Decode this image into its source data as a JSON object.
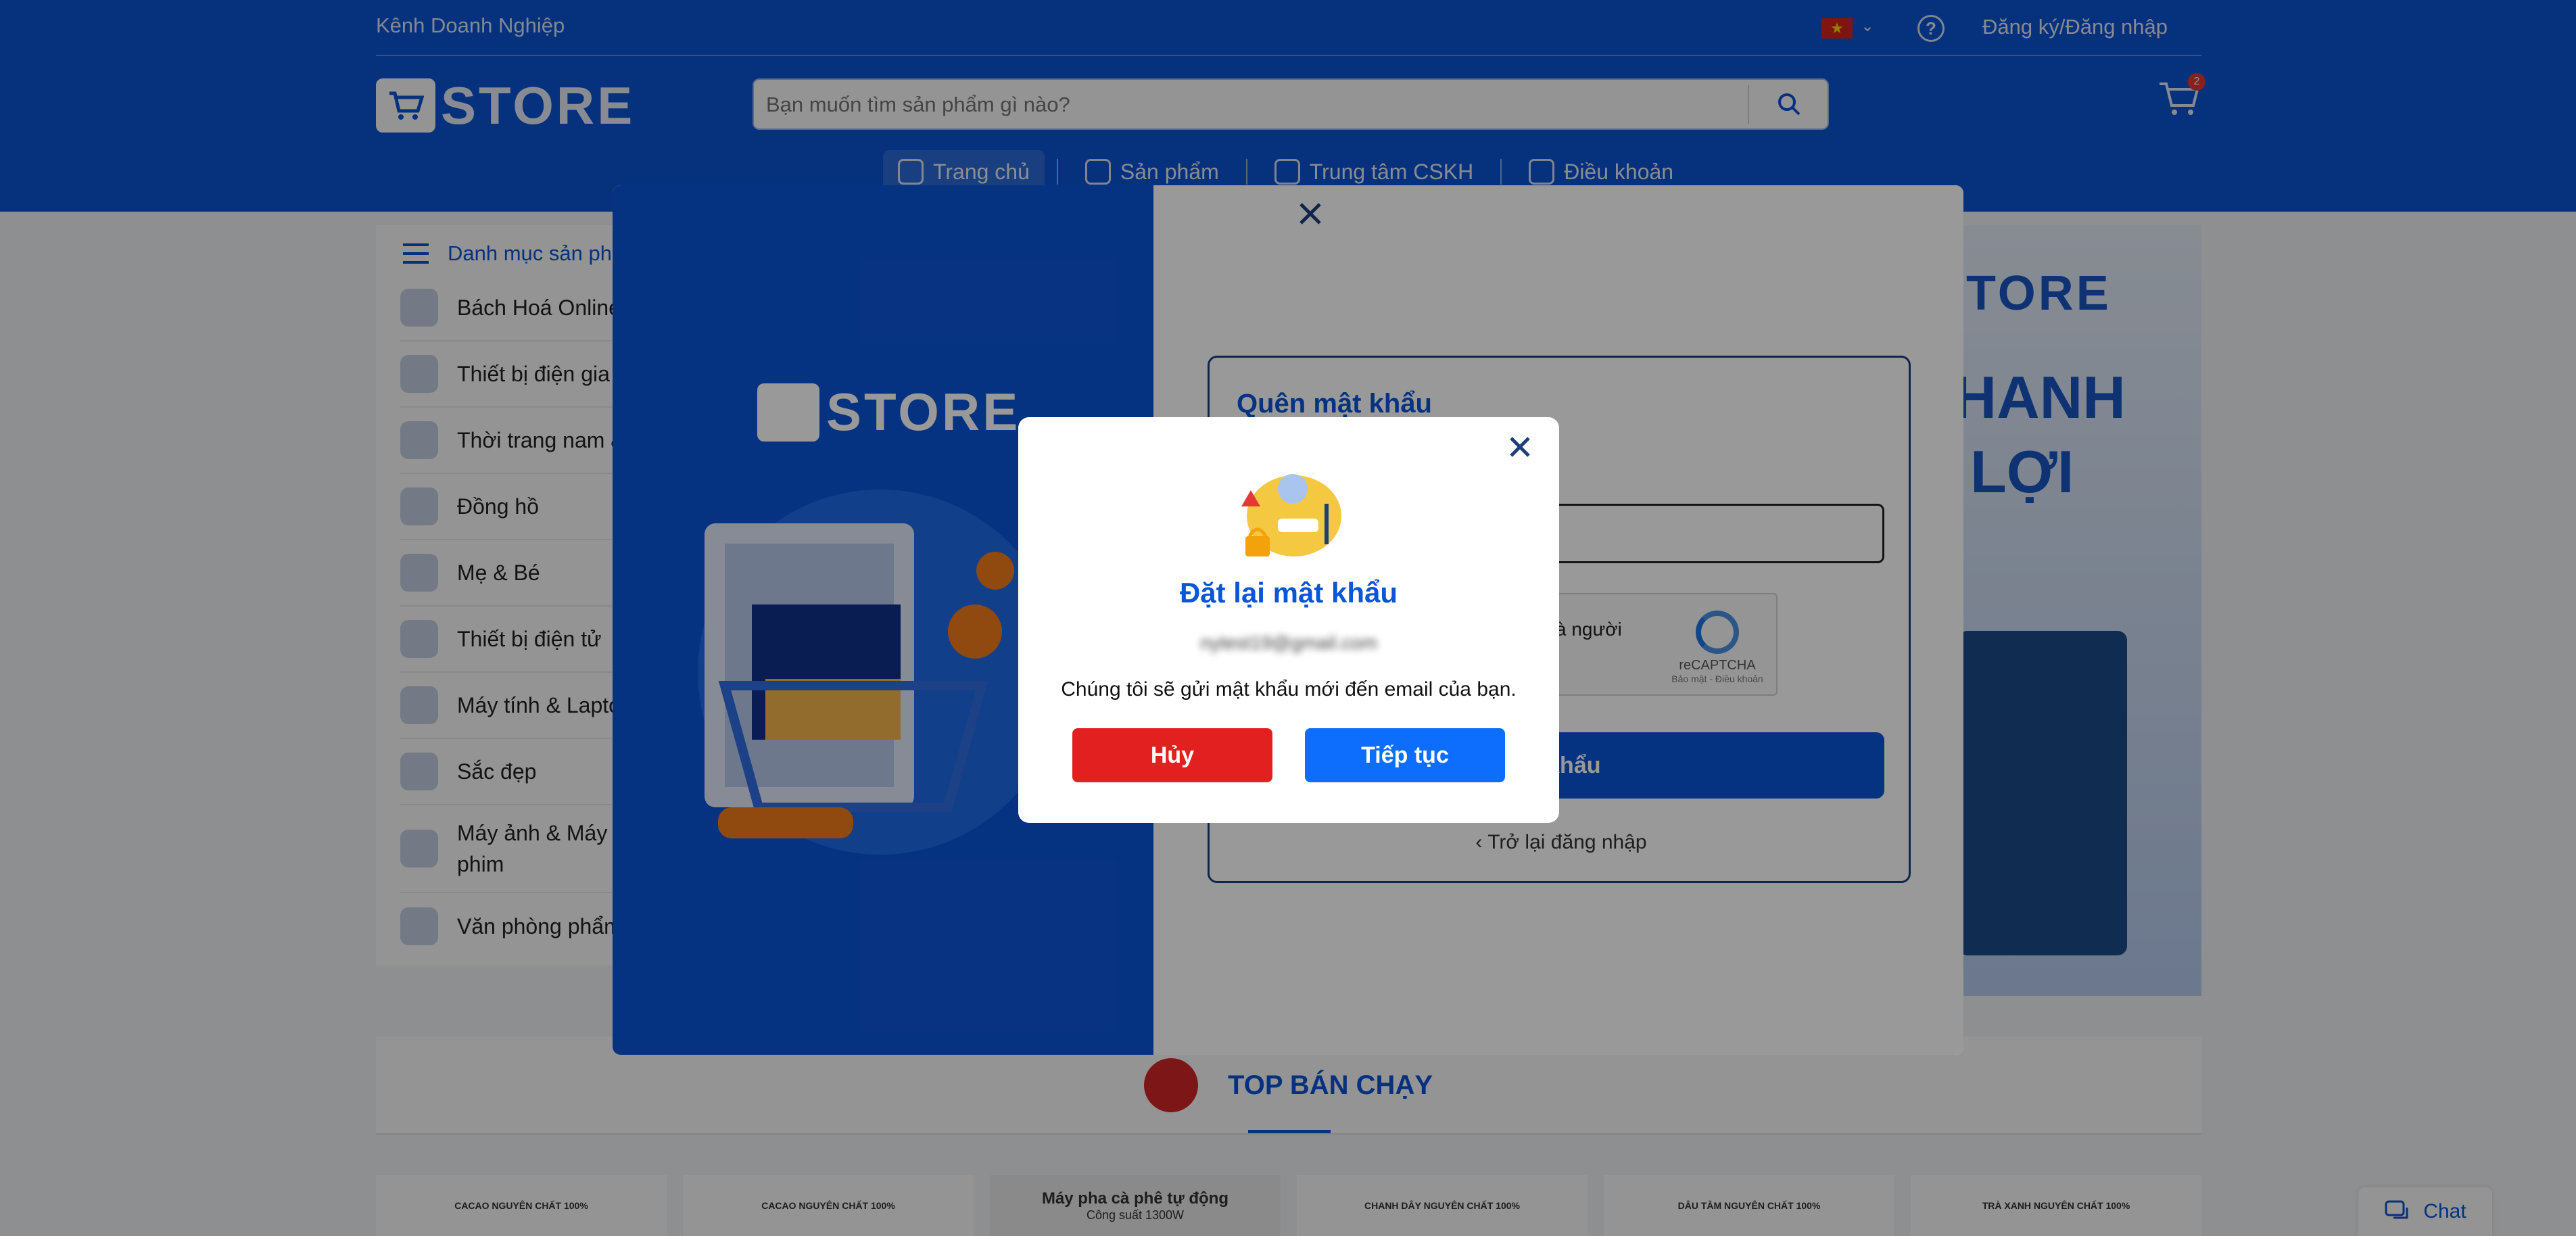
{
  "header": {
    "business_channel": "Kênh Doanh Nghiệp",
    "login_register": "Đăng ký/Đăng nhập",
    "logo_text": "STORE",
    "search_placeholder": "Bạn muốn tìm sản phẩm gì nào?",
    "cart_count": "2",
    "nav": [
      {
        "label": "Trang chủ",
        "active": true
      },
      {
        "label": "Sản phẩm"
      },
      {
        "label": "Trung tâm CSKH"
      },
      {
        "label": "Điều khoản"
      }
    ]
  },
  "sidebar": {
    "title": "Danh mục sản ph",
    "items": [
      {
        "label": "Bách Hoá Online"
      },
      {
        "label": "Thiết bị điện gia d"
      },
      {
        "label": "Thời trang nam &"
      },
      {
        "label": "Đồng hồ"
      },
      {
        "label": "Mẹ & Bé"
      },
      {
        "label": "Thiết bị điện tử"
      },
      {
        "label": "Máy tính & Lapto"
      },
      {
        "label": "Sắc đẹp"
      },
      {
        "label": "Máy ảnh & Máy q",
        "label2": "phim"
      },
      {
        "label": "Văn phòng phẩm"
      }
    ]
  },
  "banner": {
    "brand": "STORE",
    "line1": "NHANH",
    "line2": "N LỢI"
  },
  "top_selling": {
    "title": "TOP BÁN CHẠY"
  },
  "products": [
    {
      "label": "CACAO NGUYÊN CHẤT 100%"
    },
    {
      "label": "CACAO NGUYÊN CHẤT 100%"
    },
    {
      "label": "Máy pha cà phê tự động",
      "sub": "Công suất 1300W"
    },
    {
      "label": "CHANH DÂY NGUYÊN CHẤT 100%"
    },
    {
      "label": "DÂU TẰM NGUYÊN CHẤT 100%"
    },
    {
      "label": "TRÀ XANH NGUYÊN CHẤT 100%"
    }
  ],
  "chat": {
    "label": "Chat"
  },
  "forgot_modal": {
    "logo_text": "STORE",
    "title": "Quên mật khẩu",
    "captcha_text": "à người",
    "captcha_brand": "reCAPTCHA",
    "captcha_links": "Bảo mật - Điều khoản",
    "submit_label": "ật khẩu",
    "back_label": "Trở lại đăng nhập"
  },
  "reset_dialog": {
    "title": "Đặt lại mật khẩu",
    "email": "nytest19@gmail.com",
    "message": "Chúng tôi sẽ gửi mật khẩu mới đến email của bạn.",
    "cancel_label": "Hủy",
    "continue_label": "Tiếp tục"
  },
  "colors": {
    "brand_blue": "#0b55d8",
    "cancel_red": "#e32020",
    "continue_blue": "#0d6efd"
  }
}
